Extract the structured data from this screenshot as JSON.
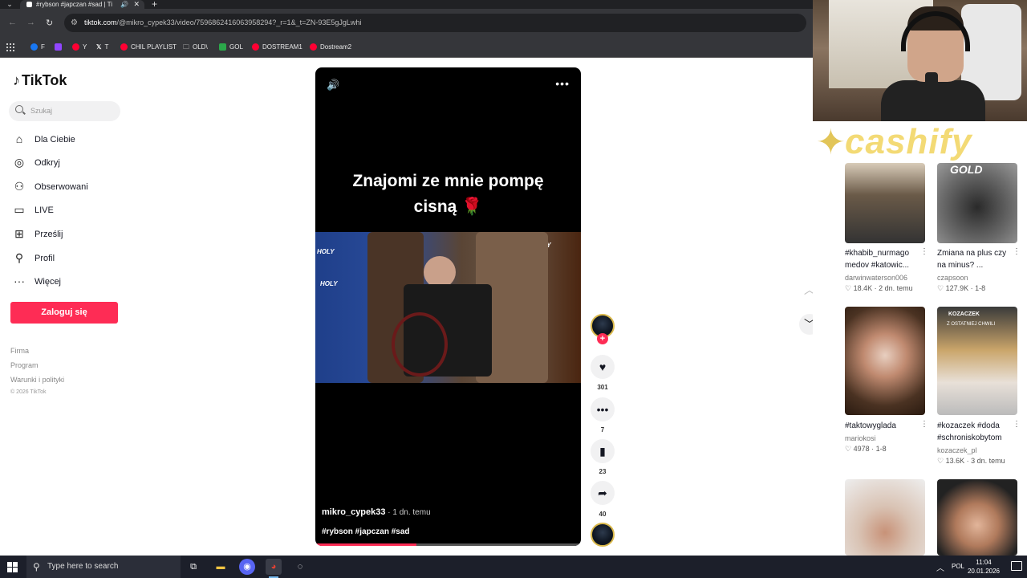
{
  "browser": {
    "tab_title": "#rybson #japczan #sad | Ti",
    "url_domain": "tiktok.com",
    "url_path": "/@mikro_cypek33/video/7596862416063958294?_r=1&_t=ZN-93E5gJgLwhi",
    "bookmarks": [
      "F",
      "",
      "Y",
      "T",
      "CHIL PLAYLIST",
      "OLD\\",
      "GOL",
      "DOSTREAM1",
      "Dostream2"
    ]
  },
  "sidebar": {
    "logo": "TikTok",
    "search_placeholder": "Szukaj",
    "nav": [
      {
        "label": "Dla Ciebie",
        "icon": "home-icon"
      },
      {
        "label": "Odkryj",
        "icon": "compass-icon"
      },
      {
        "label": "Obserwowani",
        "icon": "following-icon"
      },
      {
        "label": "LIVE",
        "icon": "live-icon"
      },
      {
        "label": "Prześlij",
        "icon": "upload-icon"
      },
      {
        "label": "Profil",
        "icon": "profile-icon"
      },
      {
        "label": "Więcej",
        "icon": "more-icon"
      }
    ],
    "login_label": "Zaloguj się",
    "footer_links": [
      "Firma",
      "Program",
      "Warunki i polityki"
    ],
    "copyright": "© 2026 TikTok"
  },
  "video": {
    "caption_line1": "Znajomi ze mnie pompę",
    "caption_line2": "cisną 🌹",
    "username": "mikro_cypek33",
    "posted": " · 1 dn. temu",
    "hashtags": "#rybson #japczan #sad",
    "progress": 0.38,
    "actions": {
      "likes": "301",
      "comments": "7",
      "saves": "23",
      "shares": "40"
    }
  },
  "overlay": {
    "sponsor": "cashify",
    "card1_badge": "GOLD",
    "card4_badge": "KOZACZEK",
    "card4_sub": "Z OSTATNIEJ CHWILI"
  },
  "recommended": [
    {
      "title": "#khabib_nurmago medov #katowic...",
      "author": "darwinwaterson006",
      "meta": "♡ 18.4K · 2 dn. temu"
    },
    {
      "title": "Zmiana na plus czy na minus? 󠀠󠀠...",
      "author": "czapsoon",
      "meta": "♡ 127.9K · 1-8"
    },
    {
      "title": "#taktowyglada",
      "author": "mariokosi",
      "meta": "♡ 4978 · 1-8"
    },
    {
      "title": "#kozaczek #doda #schroniskobytom",
      "author": "kozaczek_pl",
      "meta": "♡ 13.6K · 3 dn. temu"
    }
  ],
  "taskbar": {
    "search_placeholder": "Type here to search",
    "lang": "POL",
    "time": "11:04",
    "date": "20.01.2026"
  },
  "colors": {
    "accent": "#fe2c55",
    "text": "#161823"
  }
}
